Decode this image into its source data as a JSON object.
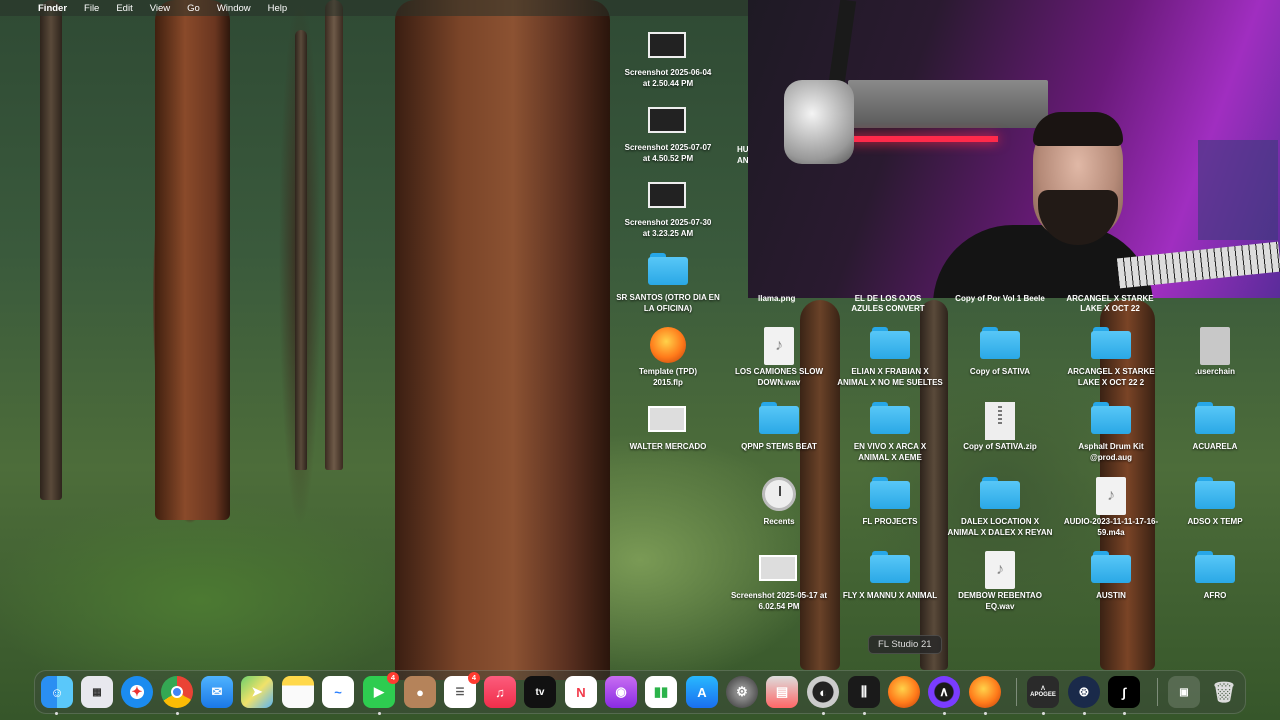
{
  "menubar": {
    "apple_icon": "apple-icon",
    "items": [
      {
        "label": "Finder",
        "bold": true
      },
      {
        "label": "File"
      },
      {
        "label": "Edit"
      },
      {
        "label": "View"
      },
      {
        "label": "Go"
      },
      {
        "label": "Window"
      },
      {
        "label": "Help"
      }
    ]
  },
  "webcam": {
    "overlay_labels": [
      "llama.png",
      "EL DE LOS OJOS AZULES CONVERT",
      "Copy of Por Vol 1 Beele",
      "ARCANGEL X STARKE LAKE X OCT 22"
    ]
  },
  "partial_labels": {
    "hu": "HU",
    "an": "AN"
  },
  "desktop_icons": {
    "screenshot1": "Screenshot 2025-06-04\nat 2.50.44 PM",
    "screenshot2": "Screenshot 2025-07-07\nat 4.50.52 PM",
    "screenshot3": "Screenshot 2025-07-30\nat 3.23.25 AM",
    "sr_santos": "SR SANTOS (OTRO DIA EN\nLA OFICINA)",
    "template": "Template (TPD)\n2015.flp",
    "walter": "WALTER MERCADO",
    "camiones": "LOS CAMIONES SLOW\nDOWN.wav",
    "elian": "ELIAN X FRABIAN X\nANIMAL X NO ME SUELTES",
    "copy_sativa": "Copy of SATIVA",
    "arcangel2": "ARCANGEL X STARKE\nLAKE X OCT 22 2",
    "userchain": ".userchain",
    "qpnp": "QPNP STEMS BEAT",
    "en_vivo": "EN VIVO X ARCA X\nANIMAL X AEME",
    "copy_sativa_zip": "Copy of SATIVA.zip",
    "asphalt": "Asphalt Drum Kit\n@prod.aug",
    "acuarela": "ACUARELA",
    "recents": "Recents",
    "fl_projects": "FL PROJECTS",
    "dalex": "DALEX LOCATION X\nANIMAL X DALEX X REYAN",
    "audio": "AUDIO-2023-11-11-17-16-\n59.m4a",
    "adso": "ADSO X TEMP",
    "screenshot4": "Screenshot 2025-05-17 at\n6.02.54 PM",
    "fly": "FLY X MANNU X ANIMAL",
    "dembow": "DEMBOW REBENTAO\nEQ.wav",
    "austin": "AUSTIN",
    "afro": "AFRO"
  },
  "tooltip": "FL Studio 21",
  "dock": {
    "facetime_badge": "4",
    "reminders_badge": "4",
    "tv_label": "tv",
    "apogee_label": "APOGEE",
    "items": [
      "Finder",
      "Launchpad",
      "Safari",
      "Chrome",
      "Mail",
      "Maps",
      "Notes",
      "Freeform",
      "FaceTime",
      "Contacts",
      "Reminders",
      "Music",
      "TV",
      "News",
      "Podcasts",
      "Numbers",
      "App Store",
      "System Settings",
      "Preview",
      "Logic",
      "Mixer",
      "FL Studio 21",
      "Pro Tools",
      "FL Studio",
      "Apogee",
      "Settings",
      "Splice",
      "Downloads",
      "Trash"
    ]
  }
}
